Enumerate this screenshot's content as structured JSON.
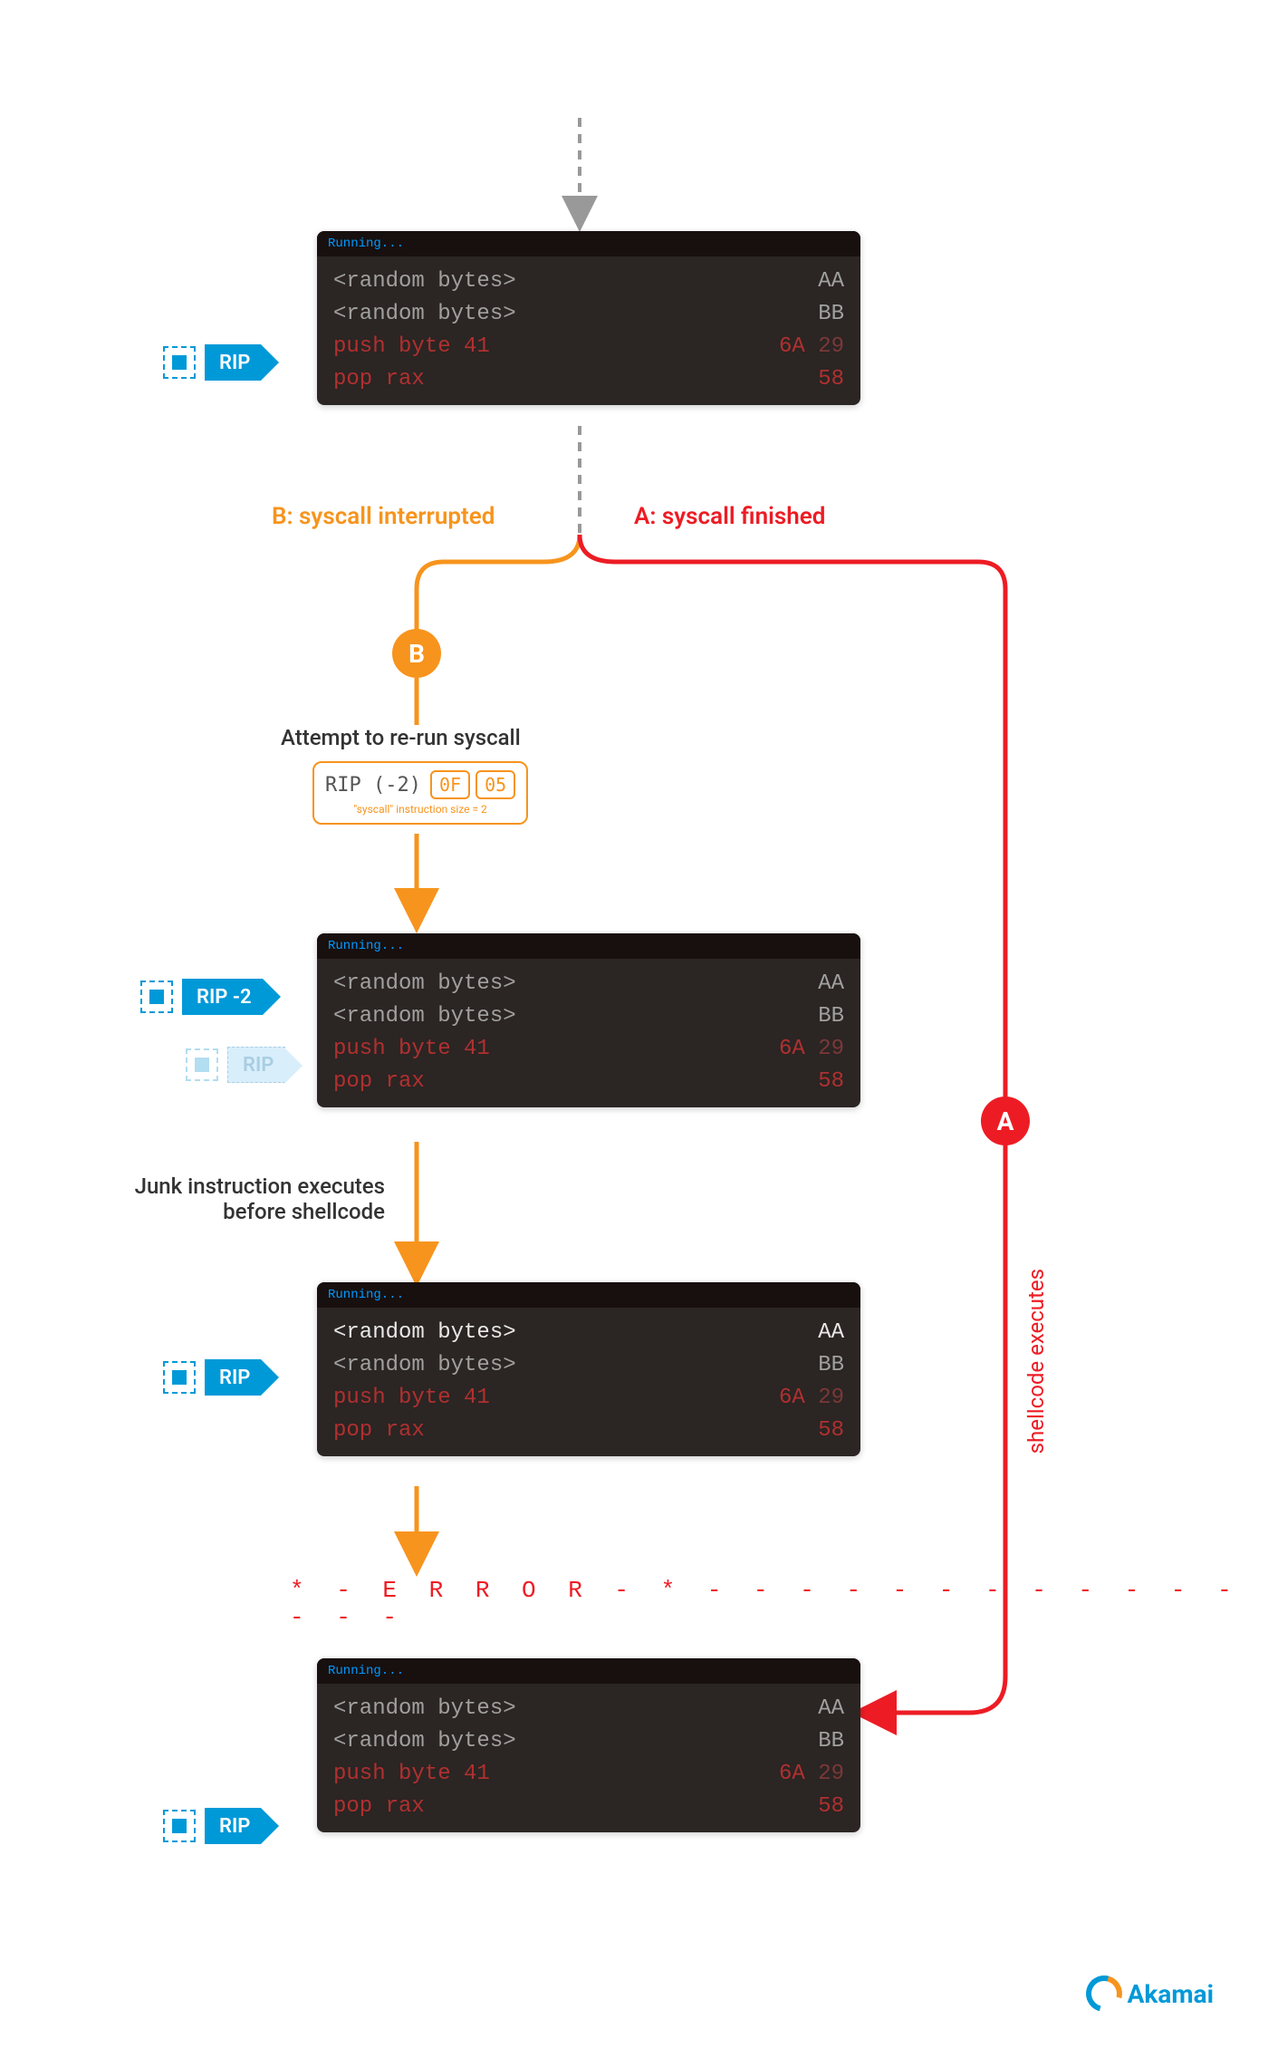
{
  "codebox_header": "Running...",
  "lines": {
    "l1_left": "<random bytes>",
    "l1_right": "AA",
    "l2_left": "<random bytes>",
    "l2_right": "BB",
    "l3_left": "push byte 41",
    "l3_right_a": "6A",
    "l3_right_b": "29",
    "l4_left": "pop rax",
    "l4_right": "58"
  },
  "rip_labels": {
    "rip": "RIP",
    "rip_m2": "RIP -2"
  },
  "flow": {
    "b_label": "B: syscall interrupted",
    "a_label": "A: syscall finished",
    "attempt": "Attempt to re-run syscall",
    "junk": "Junk instruction executes\nbefore shellcode",
    "shellcode_exec": "shellcode executes",
    "badge_b": "B",
    "badge_a": "A"
  },
  "ripbox": {
    "text": "RIP (-2)",
    "b1": "0F",
    "b2": "05",
    "sub": "\"syscall\" instruction size = 2"
  },
  "error": "* - E R R O R - * - - - - - - - - - - - - - - -",
  "logo": "Akamai"
}
